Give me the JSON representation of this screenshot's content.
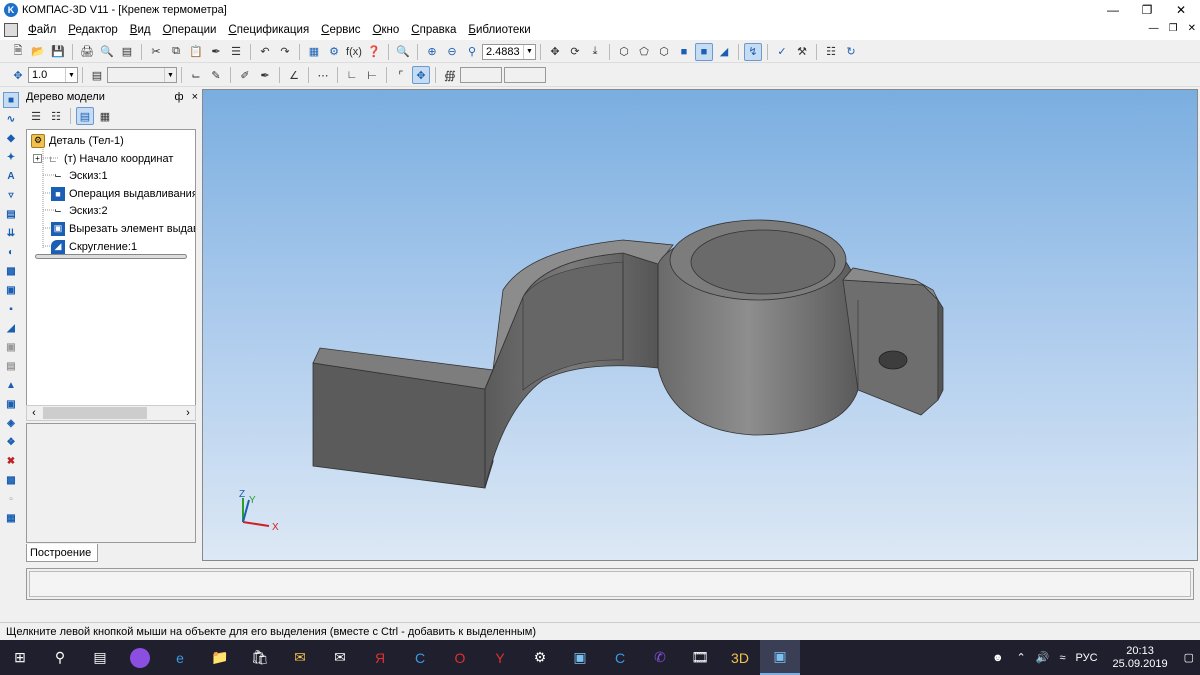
{
  "window": {
    "title": "КОМПАС-3D V11 - [Крепеж термометра]",
    "app_icon_letter": "K"
  },
  "menu": [
    "Файл",
    "Редактор",
    "Вид",
    "Операции",
    "Спецификация",
    "Сервис",
    "Окно",
    "Справка",
    "Библиотеки"
  ],
  "toolbar_main": {
    "zoom_value": "2.4883"
  },
  "toolbar_second": {
    "step_value": "1.0"
  },
  "tree": {
    "header": "Дерево модели",
    "pin_label": "ф",
    "close_label": "×",
    "nodes": [
      {
        "label": "Деталь (Тел-1)",
        "icon": "part-icon"
      },
      {
        "label": "(т) Начало координат",
        "icon": "origin-icon"
      },
      {
        "label": "Эскиз:1",
        "icon": "sketch-icon"
      },
      {
        "label": "Операция выдавливания",
        "icon": "extrude-icon"
      },
      {
        "label": "Эскиз:2",
        "icon": "sketch-icon"
      },
      {
        "label": "Вырезать элемент выдав",
        "icon": "cut-extrude-icon"
      },
      {
        "label": "Скругление:1",
        "icon": "fillet-icon"
      }
    ],
    "tab_label": "Построение"
  },
  "viewport": {
    "axis_x": "X",
    "axis_y": "Y",
    "axis_z": "Z"
  },
  "status": {
    "hint": "Щелкните левой кнопкой мыши на объекте для его выделения (вместе с Ctrl - добавить к выделенным)"
  },
  "taskbar": {
    "lang": "РУС",
    "time": "20:13",
    "date": "25.09.2019"
  },
  "colors": {
    "accent": "#1a5fb4",
    "viewport_top": "#7aaee0",
    "viewport_bottom": "#dce8f5",
    "part_dark": "#5c5c5c",
    "part_light": "#8a8a8a"
  }
}
